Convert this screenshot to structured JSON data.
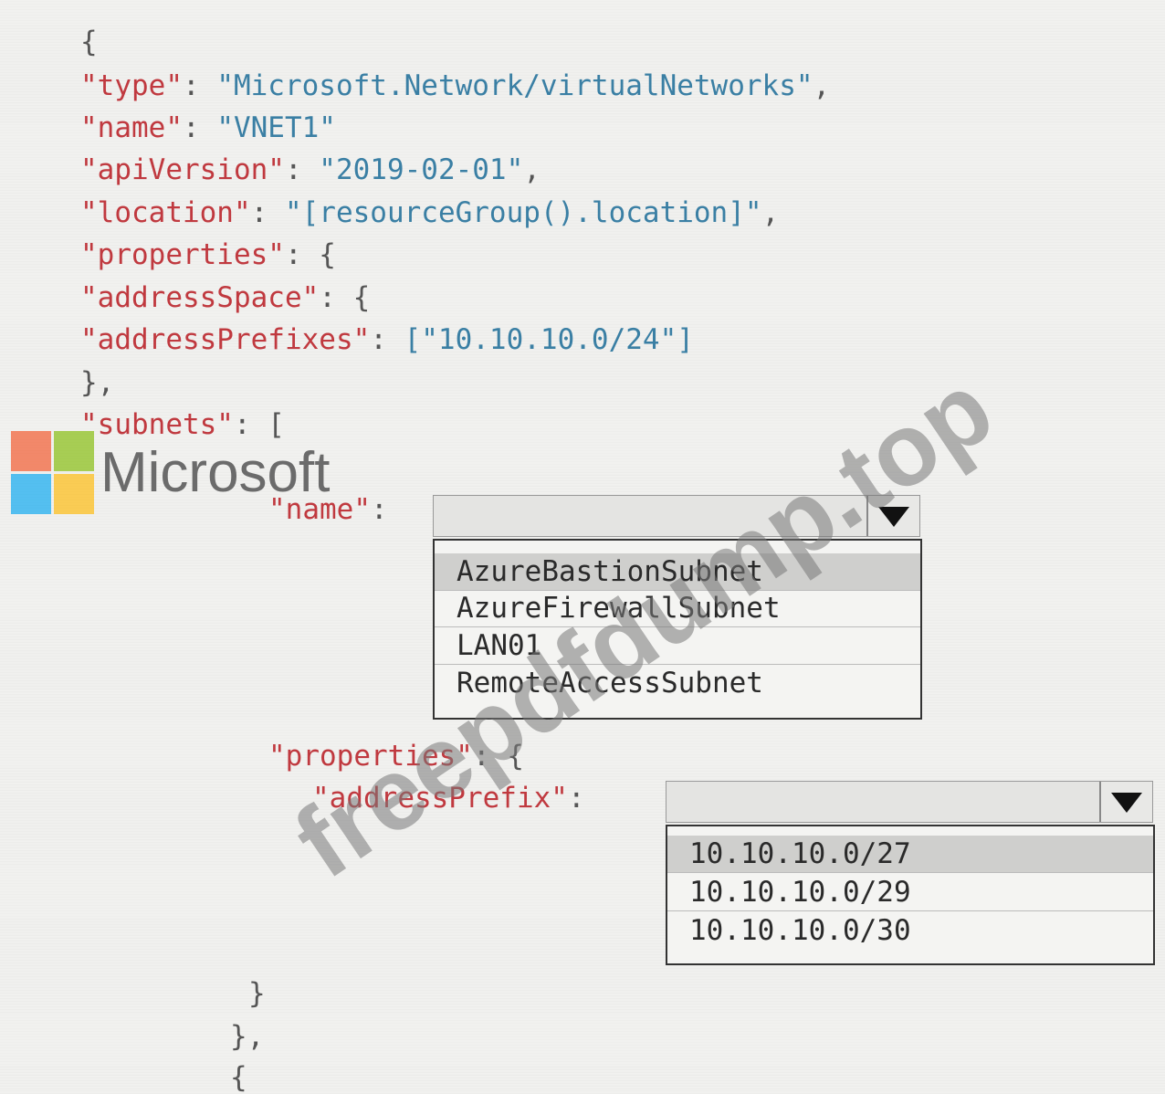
{
  "code": {
    "open_brace": "{",
    "type_key": "\"type\"",
    "type_value": "\"Microsoft.Network/virtualNetworks\"",
    "name_key": "\"name\"",
    "name_value": "\"VNET1\"",
    "apiVersion_key": "\"apiVersion\"",
    "apiVersion_value": "\"2019-02-01\"",
    "location_key": "\"location\"",
    "location_value": "\"[resourceGroup().location]\"",
    "properties_key": "\"properties\"",
    "addressSpace_key": "\"addressSpace\"",
    "addressPrefixes_key": "\"addressPrefixes\"",
    "addressPrefixes_value": "[\"10.10.10.0/24\"]",
    "close_brace_comma": "},",
    "subnets_key": "\"subnets\"",
    "subnet_name_key": "\"name\"",
    "subnet_properties_key": "\"properties\"",
    "addressPrefix_key": "\"addressPrefix\"",
    "close_brace_inner": "}",
    "close_brace_comma_2": "},",
    "open_brace_next": "{"
  },
  "name_dropdown": {
    "selected": "",
    "options": [
      "AzureBastionSubnet",
      "AzureFirewallSubnet",
      "LAN01",
      "RemoteAccessSubnet"
    ]
  },
  "prefix_dropdown": {
    "selected": "",
    "options": [
      "10.10.10.0/27",
      "10.10.10.0/29",
      "10.10.10.0/30"
    ]
  },
  "logo": {
    "text": "Microsoft",
    "colors": [
      "#f25022",
      "#7fba00",
      "#00a4ef",
      "#ffb900"
    ]
  },
  "watermark": {
    "text": "freepdfdump.top"
  }
}
